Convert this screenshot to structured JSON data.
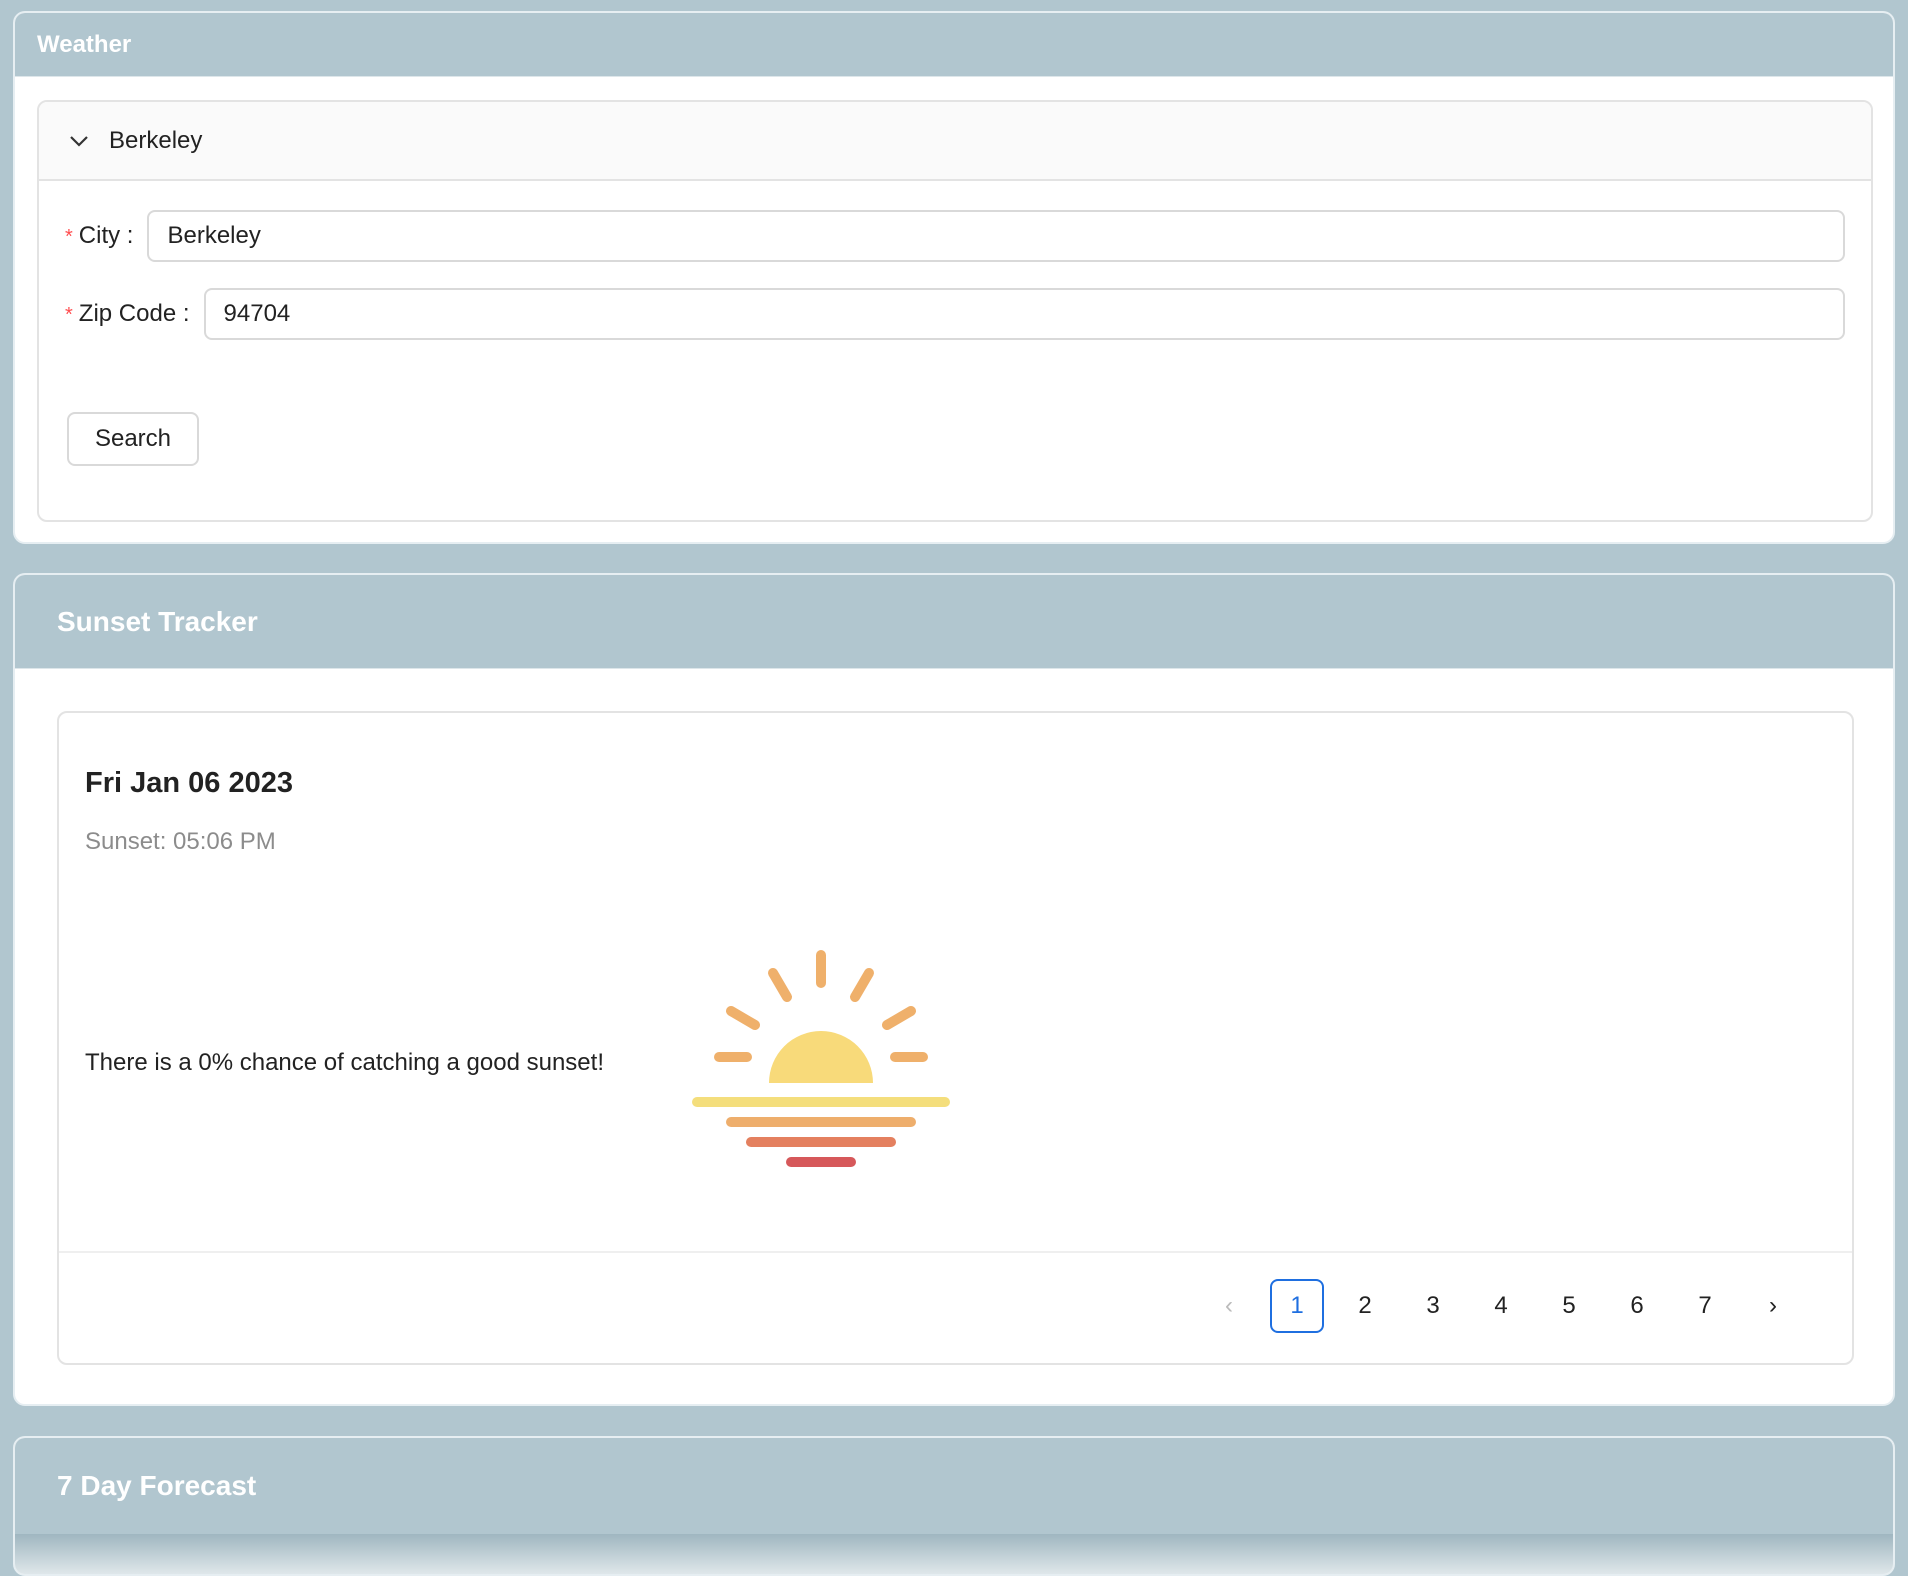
{
  "weather": {
    "title": "Weather",
    "collapse_title": "Berkeley",
    "city_label": "City",
    "city_value": "Berkeley",
    "zip_label": "Zip Code",
    "zip_value": "94704",
    "search_label": "Search"
  },
  "sunset": {
    "title": "Sunset Tracker",
    "date": "Fri Jan 06 2023",
    "time": "Sunset: 05:06 PM",
    "chance_text": "There is a 0% chance of catching a good sunset!",
    "pages": [
      "1",
      "2",
      "3",
      "4",
      "5",
      "6",
      "7"
    ],
    "active_page": "1",
    "prev": "‹",
    "next": "›"
  },
  "forecast": {
    "title": "7 Day Forecast"
  },
  "colors": {
    "panel_header": "#b1c6cf",
    "active_page": "#1f6fe0",
    "required": "#ff4d4f",
    "sun": "#f8da7a",
    "rays": "#efb06b"
  },
  "icons": [
    "chevron-down-icon",
    "sunset-icon",
    "chevron-left-icon",
    "chevron-right-icon"
  ]
}
